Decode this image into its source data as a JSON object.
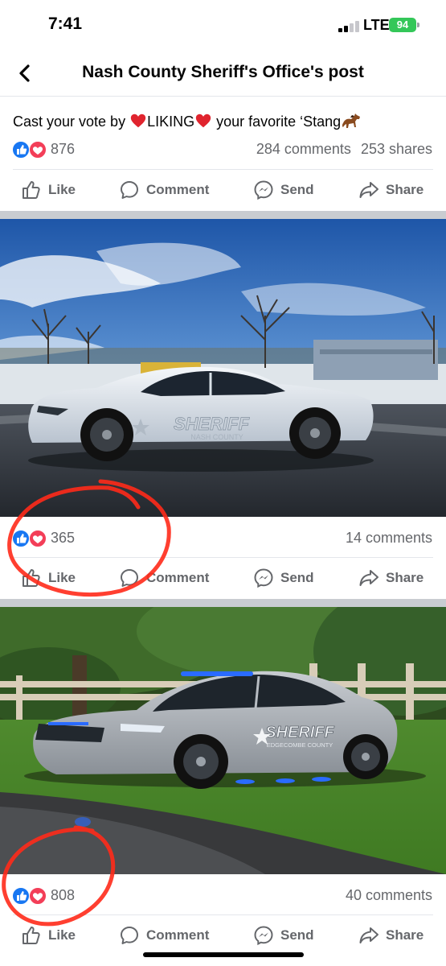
{
  "status_bar": {
    "time": "7:41",
    "network": "LTE",
    "battery": "94"
  },
  "header": {
    "title": "Nash County Sheriff's Office's post"
  },
  "post": {
    "text_before": "Cast your vote by ",
    "liking": "LIKING",
    "text_after": " your favorite ‘Stang",
    "reaction_count": "876",
    "comments": "284 comments",
    "shares": "253 shares"
  },
  "actions": {
    "like": "Like",
    "comment": "Comment",
    "send": "Send",
    "share": "Share"
  },
  "photos": [
    {
      "reaction_count": "365",
      "comments": "14 comments",
      "decal_main": "SHERIFF",
      "decal_sub": "NASH COUNTY"
    },
    {
      "reaction_count": "808",
      "comments": "40 comments",
      "decal_main": "SHERIFF",
      "decal_sub": "EDGECOMBE COUNTY"
    }
  ],
  "icons": {
    "like_reaction": "blue-thumbs-up-icon",
    "love_reaction": "red-heart-icon",
    "horse_emoji": "horse-icon"
  },
  "colors": {
    "like_blue": "#1877f2",
    "love_red": "#f33e58",
    "annotation_red": "#ff2a1a",
    "battery_green": "#34c759"
  }
}
